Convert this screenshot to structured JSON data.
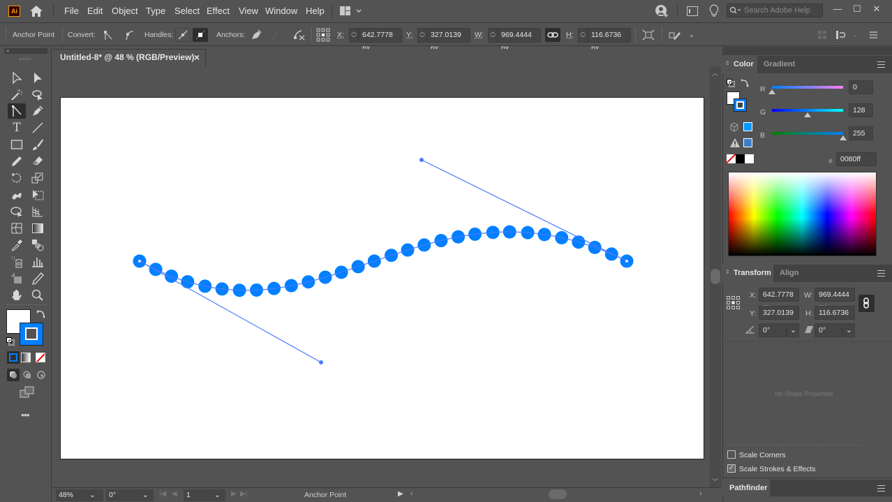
{
  "app": {
    "logo": "Ai",
    "menu": [
      "File",
      "Edit",
      "Object",
      "Type",
      "Select",
      "Effect",
      "View",
      "Window",
      "Help"
    ],
    "search_placeholder": "Search Adobe Help",
    "window_controls": {
      "minimize": "—",
      "maximize": "☐",
      "close": "✕"
    }
  },
  "control_bar": {
    "tool_name": "Anchor Point",
    "convert_label": "Convert:",
    "handles_label": "Handles:",
    "anchors_label": "Anchors:",
    "x_label": "X:",
    "x_value": "642.7778 px",
    "y_label": "Y:",
    "y_value": "327.0139 px",
    "w_label": "W:",
    "w_value": "969.4444 px",
    "h_label": "H:",
    "h_value": "116.6736 px"
  },
  "document": {
    "tab_title": "Untitled-8* @ 48 % (RGB/Preview)",
    "close_icon": "×",
    "path": {
      "stroke_color": "#0080ff",
      "guide_color": "#4a7bff",
      "anchor_start": [
        200,
        374
      ],
      "anchor_end": [
        898,
        374
      ],
      "handle_start": [
        460,
        519
      ],
      "handle_end": [
        604,
        229
      ],
      "dot_count": 30
    }
  },
  "status_bar": {
    "zoom": "48%",
    "rotation": "0°",
    "artboard_number": "1",
    "current_tool": "Anchor Point"
  },
  "color_panel": {
    "tabs": [
      "Color",
      "Gradient"
    ],
    "r_label": "R",
    "g_label": "G",
    "b_label": "B",
    "r_value": "0",
    "g_value": "128",
    "b_value": "255",
    "r_fraction": 0,
    "g_fraction": 0.502,
    "b_fraction": 1,
    "hex_label": "#",
    "hex_value": "0080ff",
    "current_color": "#0080ff",
    "websafe_color": "#0099ff",
    "gamut_color": "#3c7dc8"
  },
  "transform_panel": {
    "tabs": [
      "Transform",
      "Align"
    ],
    "x_label": "X:",
    "x_value": "642.7778 px",
    "y_label": "Y:",
    "y_value": "327.0139 px",
    "w_label": "W:",
    "w_value": "969.4444 px",
    "h_label": "H:",
    "h_value": "116.6736 px",
    "rotate_value": "0°",
    "shear_value": "0°",
    "no_shape_text": "No Shape Properties",
    "scale_corners_label": "Scale Corners",
    "scale_corners_checked": false,
    "scale_strokes_label": "Scale Strokes & Effects",
    "scale_strokes_checked": true
  },
  "pathfinder_panel": {
    "tab": "Pathfinder"
  }
}
